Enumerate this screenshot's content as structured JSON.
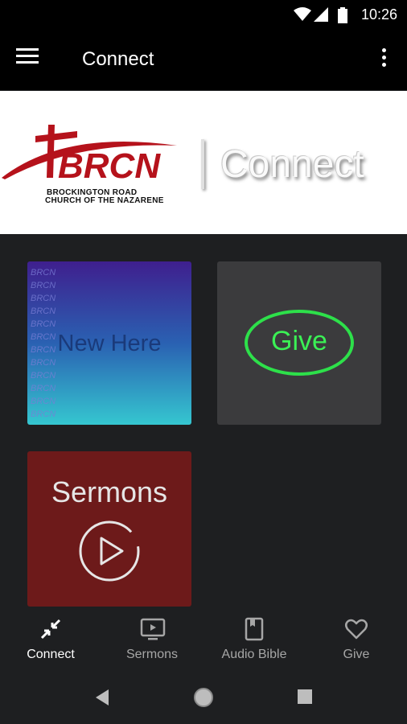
{
  "status_bar": {
    "time": "10:26"
  },
  "app_bar": {
    "title": "Connect"
  },
  "banner": {
    "logo": "BRCN",
    "org_line1": "BROCKINGTON ROAD",
    "org_line2": "CHURCH OF THE NAZARENE",
    "tagline": "Connect"
  },
  "tiles": {
    "new_here": "New Here",
    "give": "Give",
    "sermons": "Sermons"
  },
  "bottom_nav": {
    "items": [
      {
        "label": "Connect",
        "icon": "collapse-arrows-icon",
        "active": true
      },
      {
        "label": "Sermons",
        "icon": "tv-play-icon",
        "active": false
      },
      {
        "label": "Audio Bible",
        "icon": "book-icon",
        "active": false
      },
      {
        "label": "Give",
        "icon": "heart-icon",
        "active": false
      }
    ]
  },
  "colors": {
    "give_green": "#3bf055",
    "brand_red": "#b5121b",
    "sermons_bg": "#6d1a1a"
  }
}
